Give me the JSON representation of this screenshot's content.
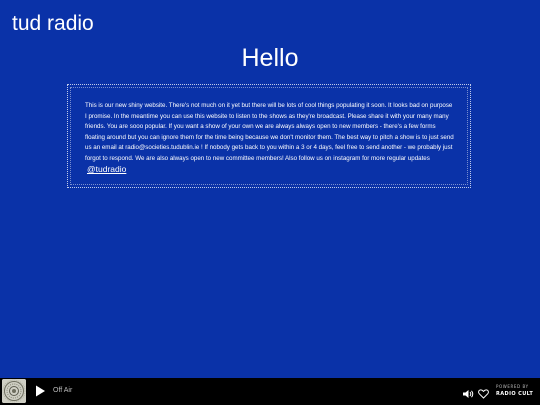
{
  "site": {
    "title": "tud radio"
  },
  "main": {
    "heading": "Hello",
    "body": "This is our new shiny website. There's not much on it yet but there will be lots of cool things populating it soon. It looks bad on purpose I promise. In the meantime you can use this website to listen to the shows as they're broadcast. Please share it with your many many friends. You are sooo popular. If you want a show of your own we are always always open to new members - there's a few forms floating around but you can ignore them for the time being because we don't monitor them. The best way to pitch a show is to just send us an email at radio@societies.tudublin.ie ! If nobody gets back to you within a 3 or 4 days, feel free to send another - we probably just forgot to respond. We are also always open to new committee members! Also follow us on instagram for more regular updates",
    "instagram_link": "@tudradio"
  },
  "player": {
    "status": "Off Air",
    "powered_by": "POWERED BY",
    "brand": "RADIO CULT",
    "icons": {
      "logo": "station-logo",
      "play": "play-icon",
      "volume": "volume-icon",
      "favorite": "heart-icon"
    }
  },
  "colors": {
    "background": "#0a32a8",
    "text": "#ffffff",
    "player_bar": "#000000",
    "status_text": "#bdbdbd"
  }
}
